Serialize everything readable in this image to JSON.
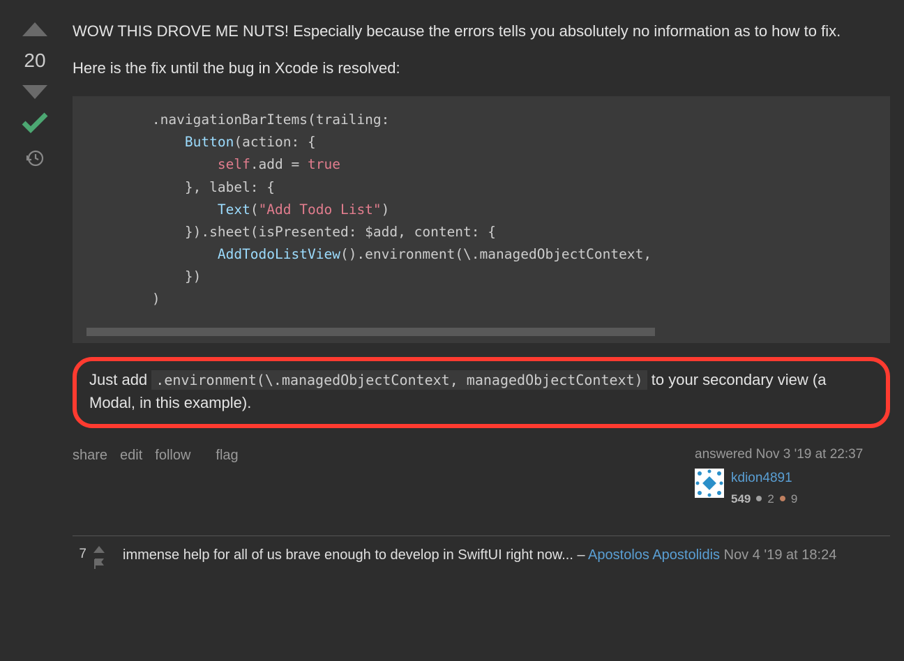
{
  "vote": {
    "score": "20"
  },
  "answer": {
    "paragraph1": "WOW THIS DROVE ME NUTS! Especially because the errors tells you absolutely no information as to how to fix.",
    "paragraph2": "Here is the fix until the bug in Xcode is resolved:",
    "code": {
      "l1a": ".navigationBarItems(trailing:",
      "l2a": "Button",
      "l2b": "(action: {",
      "l3a": "self",
      "l3b": ".add = ",
      "l3c": "true",
      "l4": "}, label: {",
      "l5a": "Text",
      "l5b": "(",
      "l5c": "\"Add Todo List\"",
      "l5d": ")",
      "l6": "}).sheet(isPresented: $add, content: {",
      "l7a": "AddTodoListView",
      "l7b": "().environment(\\.managedObjectContext,",
      "l8": "})",
      "l9": ")"
    },
    "highlight": {
      "prefix": "Just add ",
      "code": ".environment(\\.managedObjectContext, managedObjectContext)",
      "suffix": " to your secondary view (a Modal, in this example)."
    }
  },
  "actions": {
    "share": "share",
    "edit": "edit",
    "follow": "follow",
    "flag": "flag"
  },
  "user": {
    "answered_label": "answered Nov 3 '19 at 22:37",
    "name": "kdion4891",
    "reputation": "549",
    "silver_badges": "2",
    "bronze_badges": "9"
  },
  "comment": {
    "score": "7",
    "text": "immense help for all of us brave enough to develop in SwiftUI right now... – ",
    "author": "Apostolos Apostolidis",
    "date": " Nov 4 '19 at 18:24"
  }
}
